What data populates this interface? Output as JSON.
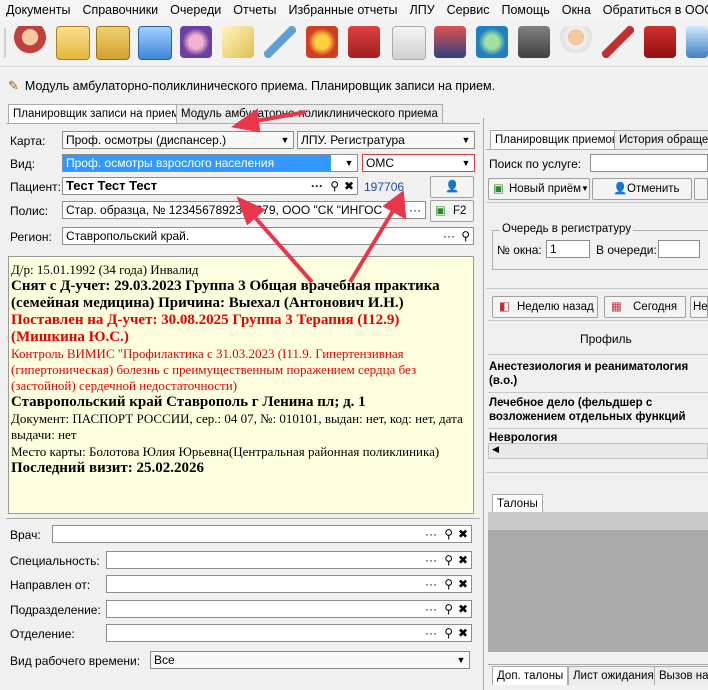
{
  "menu": [
    "Документы",
    "Справочники",
    "Очереди",
    "Отчеты",
    "Избранные отчеты",
    "ЛПУ",
    "Сервис",
    "Помощь",
    "Окна",
    "Обратиться в ООО"
  ],
  "module_title": "Модуль амбулаторно-поликлинического приема. Планировщик записи на прием.",
  "tabs": [
    "Планировщик записи на прием",
    "Модуль амбулаторно-поликлинического приема"
  ],
  "form": {
    "karta_label": "Карта:",
    "karta_value": "Проф. осмотры (диспансер.)",
    "lpu_value": "ЛПУ. Регистратура",
    "vid_label": "Вид:",
    "vid_value": "Проф. осмотры взрослого населения",
    "oms_value": "ОМС",
    "patient_label": "Пациент:",
    "patient_value": "Тест Тест Тест",
    "patient_id": "197706",
    "polis_label": "Полис:",
    "polis_value": "Стар. образца, № 1234567892354679, ООО \"СК \"ИНГОС",
    "f2": "F2",
    "region_label": "Регион:",
    "region_value": "Ставропольский край."
  },
  "info": {
    "line1": "Д/р: 15.01.1992 (34 года) Инвалид",
    "line2": "Снят с Д-учет: 29.03.2023 Группа 3 Общая врачебная практика (семейная медицина) Причина: Выехал (Антонович И.Н.)",
    "line3": "Поставлен на Д-учет: 30.08.2025 Группа 3 Терапия (I12.9) (Мишкина Ю.С.)",
    "line4": "Контроль ВИМИС \"Профилактика с 31.03.2023 (I11.9. Гипертензивная (гипертоническая) болезнь с преимущественным поражением сердца без (застойной) сердечной недостаточности)",
    "line5": "Ставропольский край Ставрополь г Ленина пл; д. 1",
    "line6": "Документ: ПАСПОРТ РОССИИ, сер.: 04 07, №: 010101, выдан: нет, код: нет, дата выдачи: нет",
    "line7": "Место карты: Болотова Юлия Юрьевна(Центральная районная поликлиника)",
    "line8": "Последний визит: 25.02.2026"
  },
  "lower": {
    "vrach": "Врач:",
    "spec": "Специальность:",
    "napr": "Направлен от:",
    "podr": "Подразделение:",
    "otd": "Отделение:",
    "vid_rab": "Вид рабочего времени:",
    "vid_rab_value": "Все"
  },
  "right": {
    "tabs": [
      "Планировщик приемов",
      "История обращен"
    ],
    "search_label": "Поиск по услуге:",
    "new_btn": "Новый приём",
    "cancel_btn": "Отменить",
    "queue_group": "Очередь в регистратуру",
    "window_label": "№ окна:",
    "window_value": "1",
    "in_queue_label": "В очереди:",
    "week_back": "Неделю назад",
    "today": "Сегодня",
    "next": "Не",
    "profile_header": "Профиль",
    "profiles": [
      "Анестезиология и реаниматология (в.о.)",
      "Лечебное дело (фельдшер с возложением отдельных функций",
      "Неврология"
    ],
    "talony": "Талоны",
    "bottom_tabs": [
      "Доп. талоны",
      "Лист ожидания",
      "Вызов на"
    ]
  },
  "colors": {
    "selection": "#3399ff",
    "accent_red": "#e60000",
    "info_bg": "#ffffe0",
    "annotation_arrow": "#e8364a"
  }
}
